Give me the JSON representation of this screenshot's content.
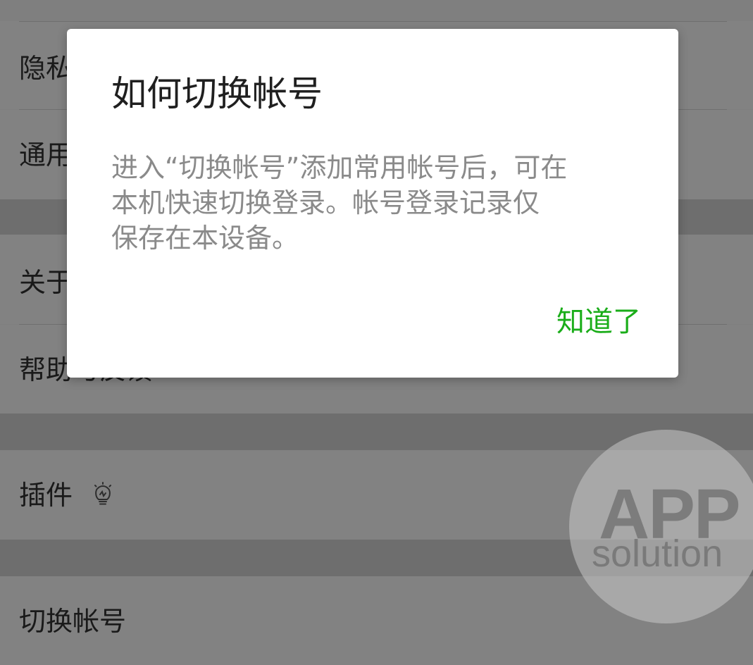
{
  "settings": {
    "items": [
      {
        "label": "隐私"
      },
      {
        "label": "通用"
      },
      {
        "label": "关于"
      },
      {
        "label": "帮助与反馈"
      },
      {
        "label": "插件"
      },
      {
        "label": "切换帐号"
      }
    ]
  },
  "dialog": {
    "title": "如何切换帐号",
    "message_lines": [
      "进入“切换帐号”添加常用帐号后，可在",
      "本机快速切换登录。帐号登录记录仅",
      "保存在本设备。"
    ],
    "ok_label": "知道了"
  },
  "watermark": {
    "line1": "APP",
    "line2": "solution"
  },
  "icons": {
    "plugin_badge": "lightbulb-icon"
  },
  "colors": {
    "accent": "#1aad19",
    "overlay": "#7f7f7f",
    "dialog_bg": "#ffffff"
  }
}
